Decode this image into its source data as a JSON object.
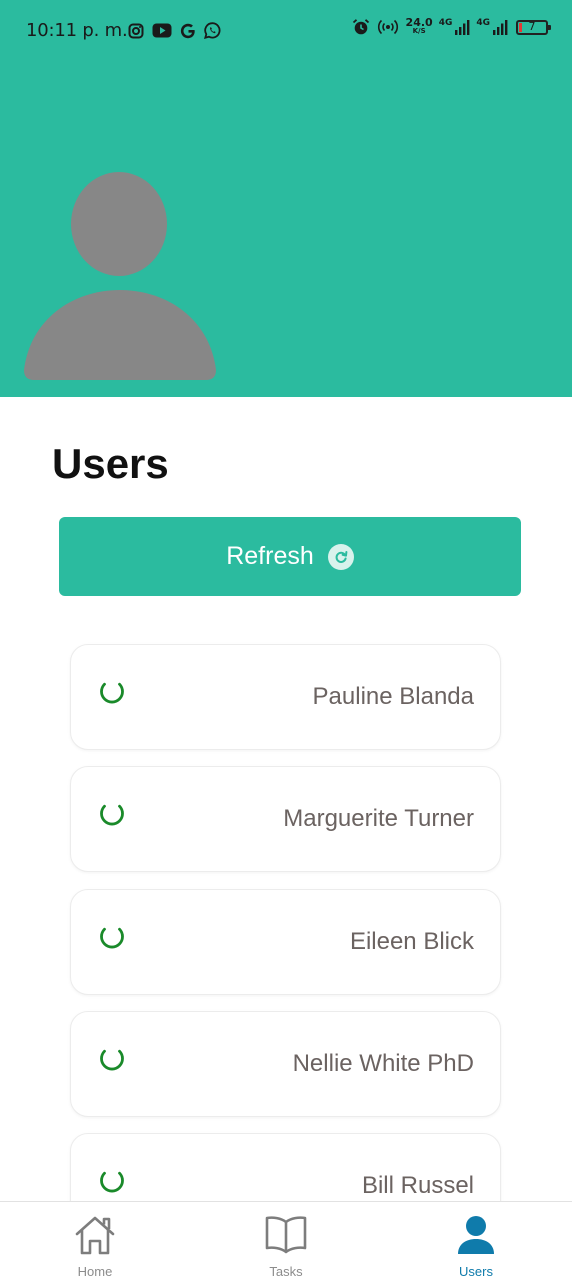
{
  "status_bar": {
    "time": "10:11 p. m.",
    "app_icons": [
      "instagram-icon",
      "youtube-icon",
      "google-icon",
      "whatsapp-icon"
    ],
    "net_speed_value": "24.0",
    "net_speed_unit": "K/S",
    "network_label_1": "4G",
    "network_label_2": "4G",
    "battery_level": "7"
  },
  "colors": {
    "accent": "#2bbb9f",
    "active_nav": "#0f7bab",
    "spinner": "#1a8a2a",
    "avatar": "#878787"
  },
  "header": {
    "avatar_icon": "user-avatar-placeholder"
  },
  "main": {
    "title": "Users",
    "refresh_button_label": "Refresh",
    "refresh_icon": "refresh-icon"
  },
  "users": [
    {
      "name": "Pauline Blanda"
    },
    {
      "name": "Marguerite Turner"
    },
    {
      "name": "Eileen Blick"
    },
    {
      "name": "Nellie White PhD"
    },
    {
      "name": "Bill Russel"
    }
  ],
  "nav": [
    {
      "label": "Home",
      "icon": "home-icon",
      "active": false
    },
    {
      "label": "Tasks",
      "icon": "book-icon",
      "active": false
    },
    {
      "label": "Users",
      "icon": "user-icon",
      "active": true
    }
  ]
}
